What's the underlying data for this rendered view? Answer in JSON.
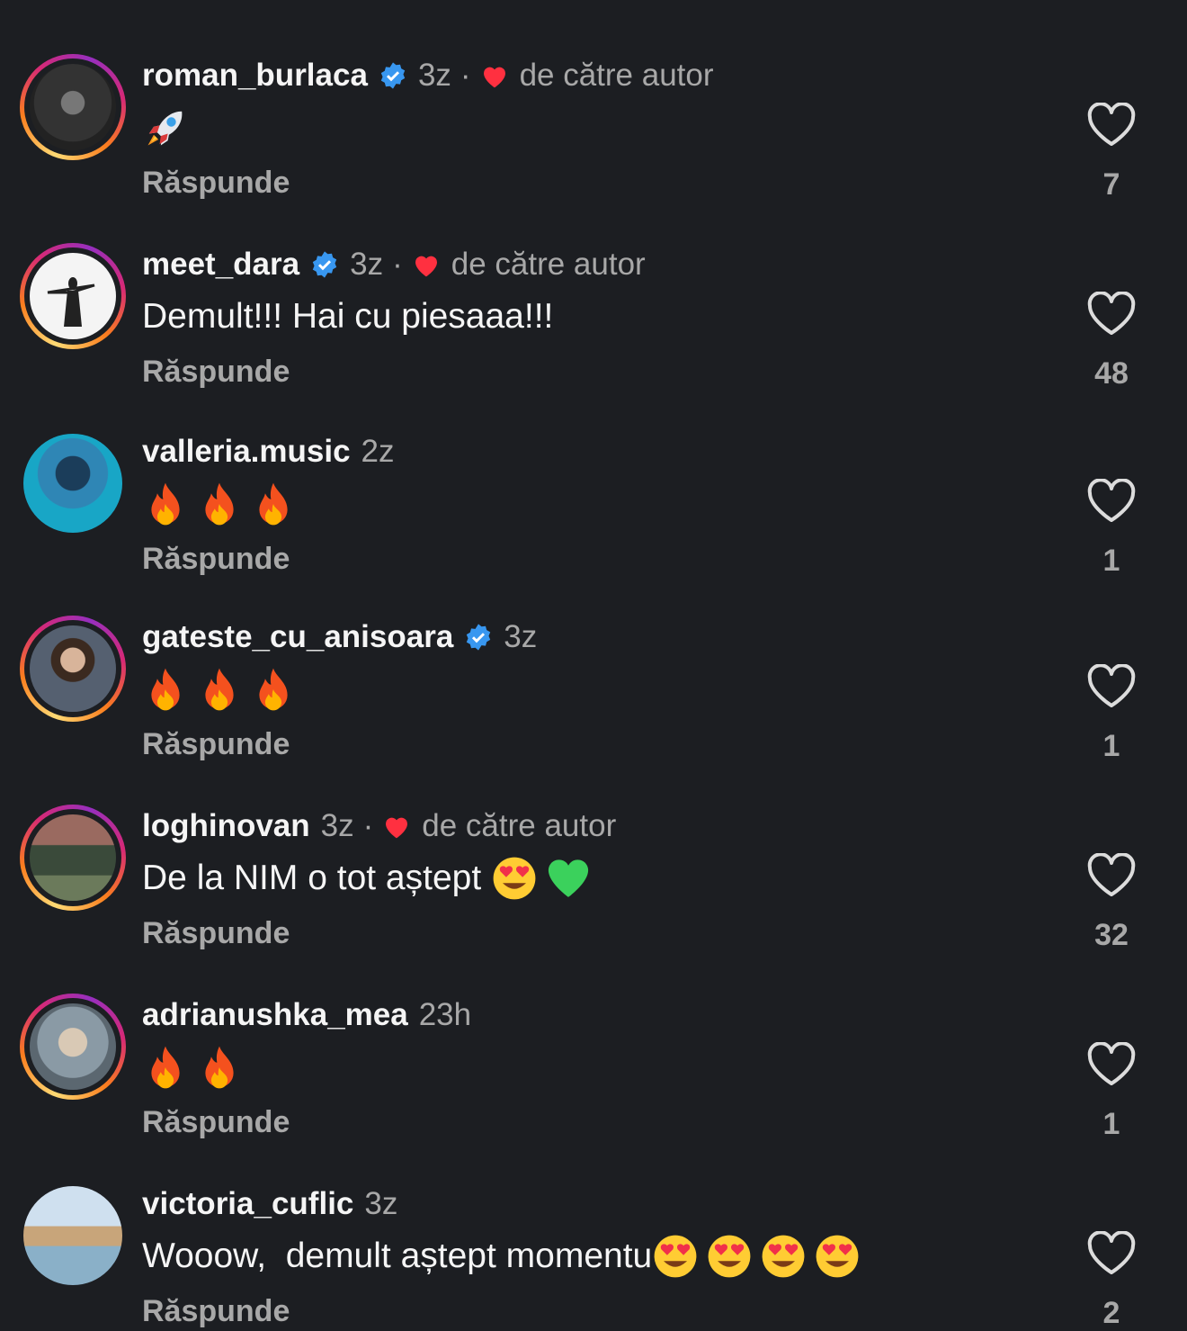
{
  "reply_label": "Răspunde",
  "author_label": "de către autor",
  "dot": "·",
  "colors": {
    "background": "#1c1e22",
    "secondary_text": "#a8a8a8",
    "verified": "#3897f0",
    "heart": "#ff3040"
  },
  "comments": [
    {
      "username": "roman_burlaca",
      "verified": true,
      "time": "3z",
      "liked_by_author": true,
      "text": "",
      "emojis": [
        "rocket"
      ],
      "likes": "7"
    },
    {
      "username": "meet_dara",
      "verified": true,
      "time": "3z",
      "liked_by_author": true,
      "text": "Demult!!! Hai cu piesaaa!!!",
      "emojis": [],
      "likes": "48"
    },
    {
      "username": "valleria.music",
      "verified": false,
      "time": "2z",
      "liked_by_author": false,
      "text": "",
      "emojis": [
        "fire",
        "fire",
        "fire"
      ],
      "likes": "1"
    },
    {
      "username": "gateste_cu_anisoara",
      "verified": true,
      "time": "3z",
      "liked_by_author": false,
      "text": "",
      "emojis": [
        "fire",
        "fire",
        "fire"
      ],
      "likes": "1"
    },
    {
      "username": "loghinovan",
      "verified": false,
      "time": "3z",
      "liked_by_author": true,
      "text": "De la NIM o tot aștept ",
      "emojis": [
        "heart-eyes",
        "green-heart"
      ],
      "likes": "32"
    },
    {
      "username": "adrianushka_mea",
      "verified": false,
      "time": "23h",
      "liked_by_author": false,
      "text": "",
      "emojis": [
        "fire",
        "fire"
      ],
      "likes": "1"
    },
    {
      "username": "victoria_cuflic",
      "verified": false,
      "time": "3z",
      "liked_by_author": false,
      "text": "Wooow,  demult aștept momentu",
      "emojis": [
        "heart-eyes",
        "heart-eyes",
        "heart-eyes",
        "heart-eyes"
      ],
      "likes": "2"
    }
  ]
}
